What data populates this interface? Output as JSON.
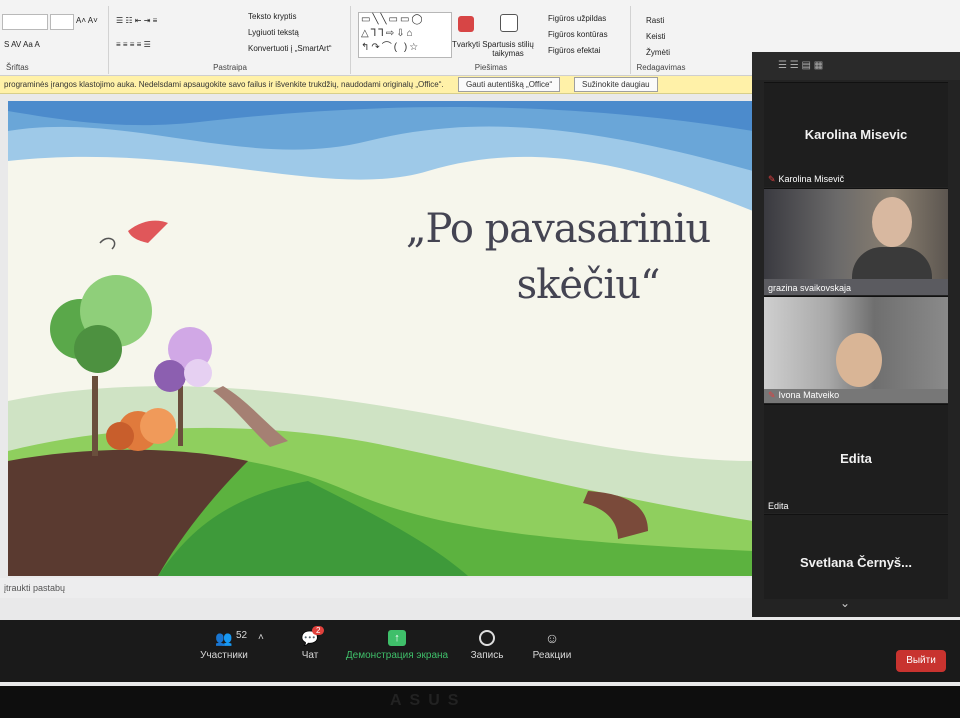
{
  "ribbon": {
    "group_font": "Šriftas",
    "group_paragraph": "Pastraipa",
    "group_drawing": "Piešimas",
    "group_editing": "Redagavimas",
    "text_direction": "Teksto kryptis",
    "align_text": "Lygiuoti tekstą",
    "convert_smartart": "Konvertuoti į „SmartArt“",
    "arrange": "Tvarkyti",
    "quick_styles": "Spartusis stilių taikymas",
    "shape_fill": "Figūros užpildas",
    "shape_outline": "Figūros kontūras",
    "shape_effects": "Figūros efektai",
    "find": "Rasti",
    "replace": "Keisti",
    "select": "Žymėti"
  },
  "warning": {
    "message": "programinės įrangos klastojimo auka. Nedelsdami apsaugokite savo failus ir išvenkite trukdžių, naudodami originalų „Office“.",
    "get_button": "Gauti autentišką „Office“",
    "learn_button": "Sužinokite daugiau"
  },
  "slide": {
    "title_line1": "„Po pavasariniu",
    "title_line2": "skėčiu“"
  },
  "notes_placeholder": "įtraukti pastabų",
  "participants_panel": {
    "tiles": [
      {
        "big_name": "Karolina Misevic",
        "tag": "Karolina Misevič",
        "muted": true
      },
      {
        "big_name": "",
        "tag": "grazina svaikovskaja",
        "muted": false
      },
      {
        "big_name": "",
        "tag": "Ivona Matveiko",
        "muted": true
      },
      {
        "big_name": "Edita",
        "tag": "Edita",
        "muted": false
      },
      {
        "big_name": "Svetlana  Černyš...",
        "tag": "",
        "muted": false
      }
    ]
  },
  "controls": {
    "participants_label": "Участники",
    "participants_count": "52",
    "chat_label": "Чат",
    "chat_badge": "2",
    "share_label": "Демонстрация экрана",
    "record_label": "Запись",
    "reactions_label": "Реакции",
    "leave_label": "Выйти"
  },
  "monitor_brand": "ASUS",
  "colors": {
    "share_green": "#3fbf6a",
    "leave_red": "#c8332f",
    "warning_bg": "#fff1a8"
  }
}
